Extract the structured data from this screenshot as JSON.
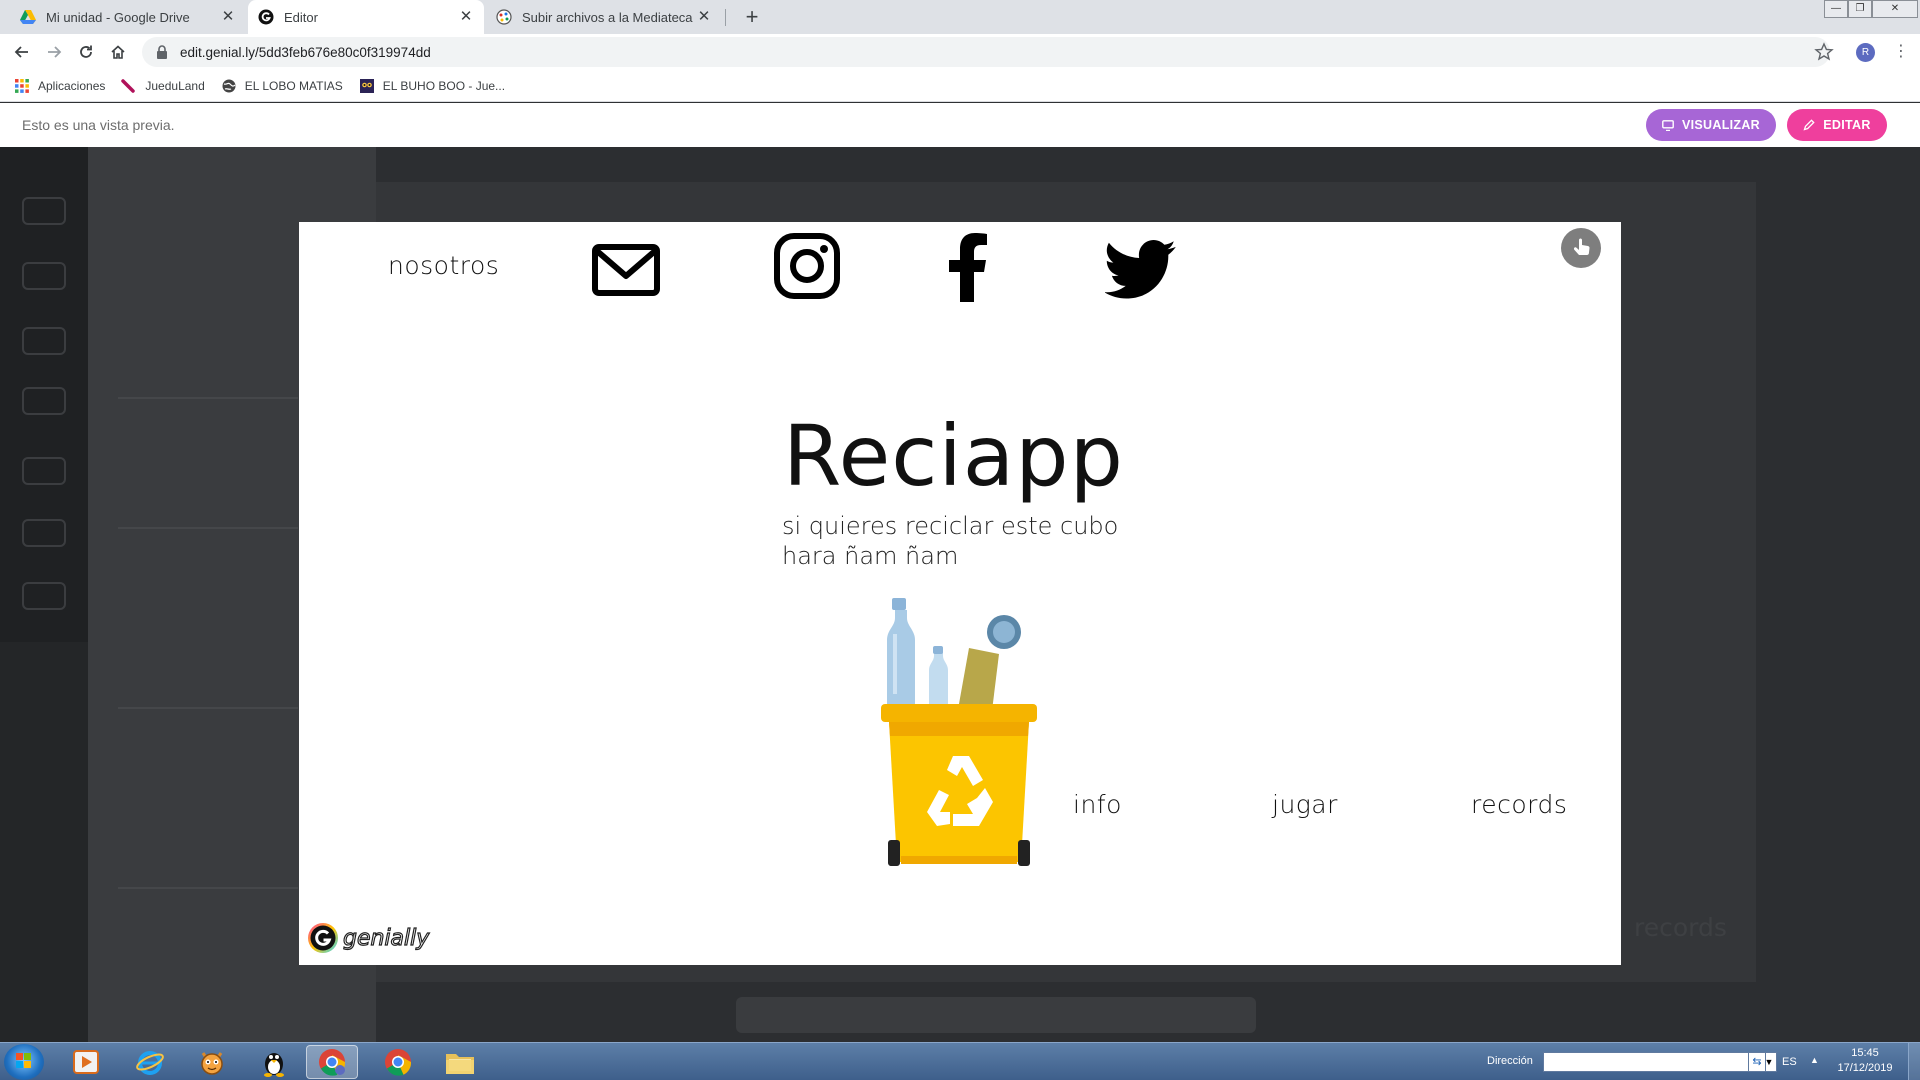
{
  "browser": {
    "tabs": [
      {
        "title": "Mi unidad - Google Drive",
        "icon": "google-drive-icon"
      },
      {
        "title": "Editor",
        "icon": "genially-icon",
        "active": true
      },
      {
        "title": "Subir archivos a la Mediateca | M",
        "icon": "mediateca-icon"
      }
    ],
    "new_tab": "+",
    "close_glyph": "✕",
    "url": "edit.genial.ly/5dd3feb676e80c0f319974dd",
    "profile_initial": "R",
    "bookmarks": [
      {
        "label": "Aplicaciones",
        "icon": "apps-grid-icon"
      },
      {
        "label": "JueduLand",
        "icon": "jueduland-icon"
      },
      {
        "label": "EL LOBO MATIAS",
        "icon": "globe-icon"
      },
      {
        "label": "EL BUHO BOO - Jue...",
        "icon": "owl-icon"
      }
    ]
  },
  "preview_bar": {
    "text": "Esto es una vista previa.",
    "visualize_label": "VISUALIZAR",
    "edit_label": "EDITAR",
    "colors": {
      "visualize": "#a766d6",
      "edit": "#ef3f9d"
    }
  },
  "slide": {
    "nav": {
      "nosotros": "nosotros"
    },
    "social_icons": [
      "mail-icon",
      "instagram-icon",
      "facebook-icon",
      "twitter-icon"
    ],
    "title": "Reciapp",
    "subtitle_line1": "si quieres reciclar este cubo",
    "subtitle_line2": "hara ñam ñam",
    "illustration": "yellow-recycling-bin-illustration",
    "bottom_links": {
      "info": "info",
      "jugar": "jugar",
      "records": "records"
    },
    "brand": "genially"
  },
  "background_ghost": {
    "records": "records"
  },
  "taskbar": {
    "apps": [
      "media-player-icon",
      "internet-explorer-icon",
      "scratch-cat-icon",
      "linux-tux-icon",
      "chrome-icon",
      "chrome-icon",
      "folder-icon"
    ],
    "address_label": "Dirección",
    "address_value": "",
    "language": "ES",
    "time": "15:45",
    "date": "17/12/2019"
  }
}
